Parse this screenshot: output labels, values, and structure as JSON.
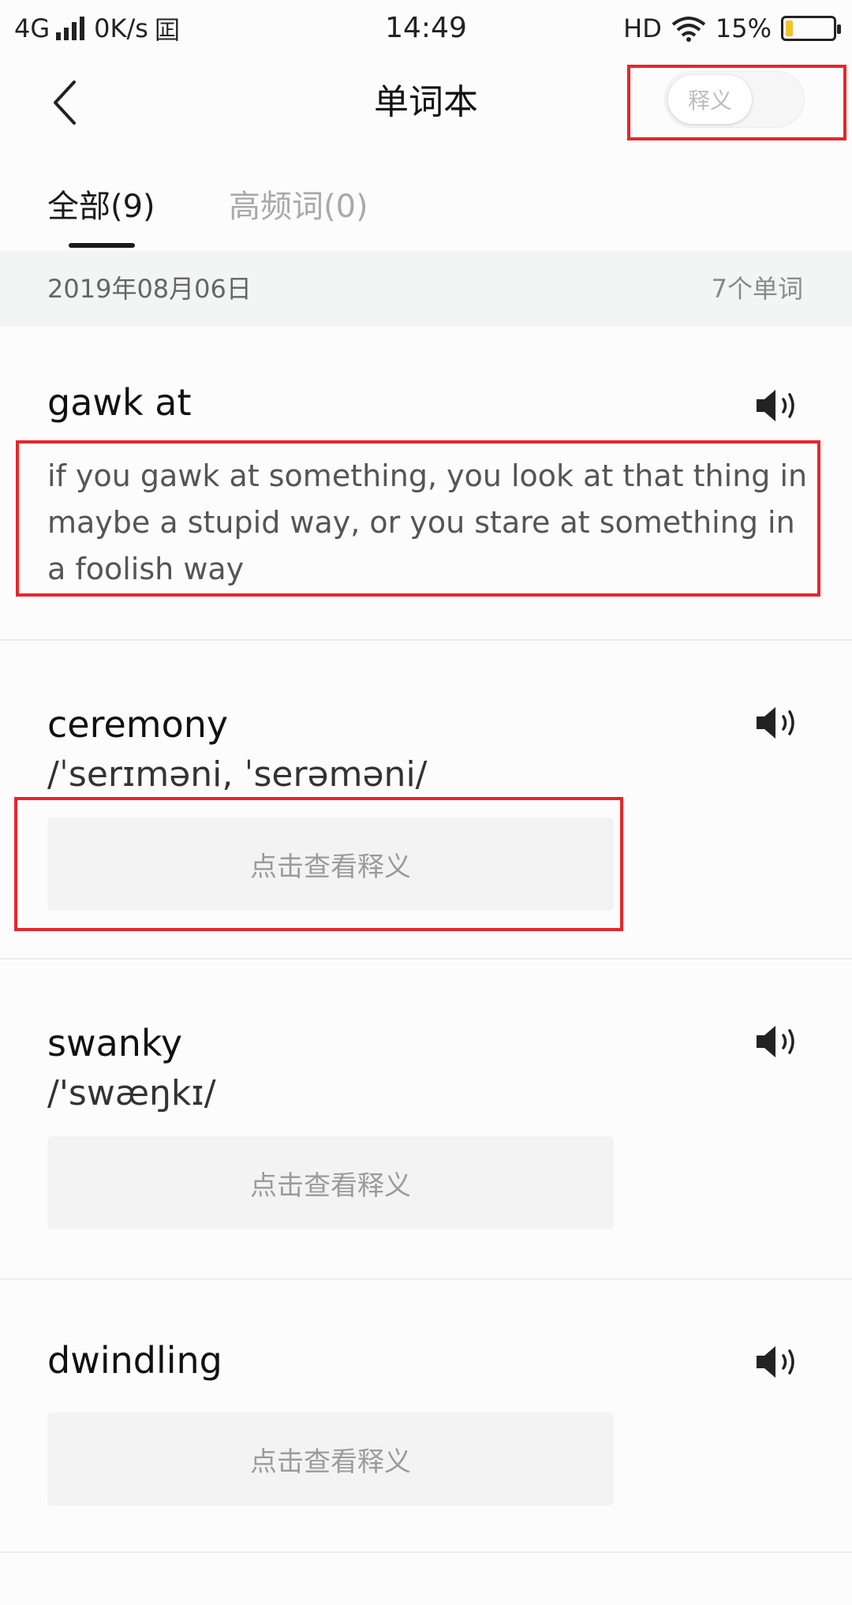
{
  "status_bar": {
    "network": "4G",
    "speed": "0K/s",
    "extra_icon": "囸",
    "time": "14:49",
    "hd": "HD",
    "battery_percent": "15%",
    "battery_level": 0.15
  },
  "header": {
    "title": "单词本",
    "back_icon": "chevron-left-icon",
    "toggle_label": "释义"
  },
  "tabs": [
    {
      "label": "全部(9)",
      "active": true
    },
    {
      "label": "高频词(0)",
      "active": false
    }
  ],
  "date_group": {
    "date": "2019年08月06日",
    "count": "7个单词"
  },
  "words": [
    {
      "word": "gawk at",
      "phonetic": "",
      "definition": "if you gawk at something, you look at that thing in maybe a stupid way, or you stare at something in a foolish way"
    },
    {
      "word": "ceremony",
      "phonetic": "/ˈserɪməni, ˈserəməni/",
      "reveal_label": "点击查看释义"
    },
    {
      "word": "swanky",
      "phonetic": "/'swæŋkɪ/",
      "reveal_label": "点击查看释义"
    },
    {
      "word": "dwindling",
      "phonetic": "",
      "reveal_label": "点击查看释义"
    }
  ],
  "colors": {
    "highlight_border": "#e8262a",
    "battery_fill": "#f2c230"
  }
}
